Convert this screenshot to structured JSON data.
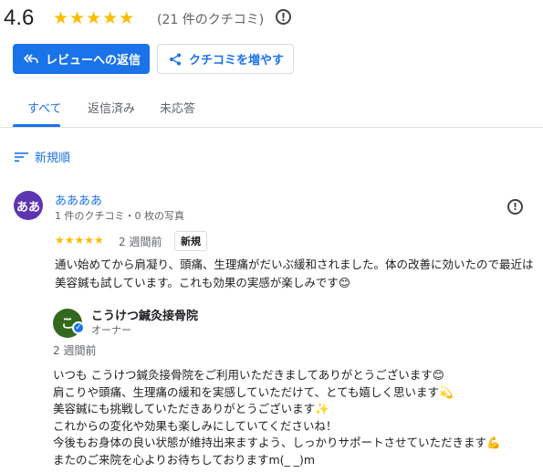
{
  "rating": {
    "score": "4.6",
    "stars": "★★★★★",
    "count_text": "(21 件のクチコミ)",
    "star_color": "#fbbc04"
  },
  "actions": {
    "reply_label": "レビューへの返信",
    "reply_icon": "reply-all-icon",
    "grow_label": "クチコミを増やす",
    "grow_icon": "share-icon"
  },
  "tabs": [
    {
      "label": "すべて",
      "active": true
    },
    {
      "label": "返信済み",
      "active": false
    },
    {
      "label": "未応答",
      "active": false
    }
  ],
  "sort": {
    "label": "新規順",
    "icon": "sort-icon"
  },
  "review": {
    "avatar_text": "ああ",
    "avatar_color": "#5e35b1",
    "name": "ああああ",
    "meta": "1 件のクチコミ・0 枚の写真",
    "stars": "★★★★★",
    "time": "2 週間前",
    "badge": "新規",
    "text": "通い始めてから肩凝り、頭痛、生理痛がだいぶ緩和されました。体の改善に効いたので最近は美容鍼も試しています。これも効果の実感が楽しみです😊"
  },
  "reply": {
    "avatar_text": "こ",
    "avatar_color": "#33691e",
    "owner_name": "こうけつ鍼灸接骨院",
    "owner_role": "オーナー",
    "time": "2 週間前",
    "lines": [
      "いつも こうけつ鍼灸接骨院をご利用いただきましてありがとうございます😊",
      "肩こりや頭痛、生理痛の緩和を実感していただけて、とても嬉しく思います💫",
      "美容鍼にも挑戦していただきありがとうございます✨",
      "これからの変化や効果も楽しみにしていてくださいね！",
      "今後もお身体の良い状態が維持出来ますよう、しっかりサポートさせていただきます💪",
      "またのご来院を心よりお待ちしておりますm(_ _)m"
    ]
  },
  "accent_color": "#1a73e8"
}
